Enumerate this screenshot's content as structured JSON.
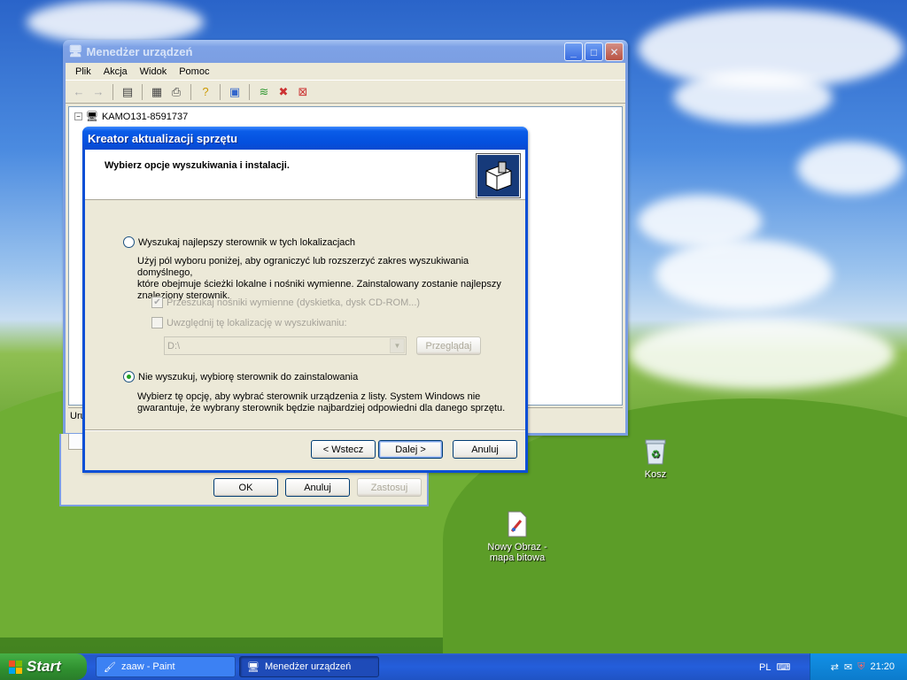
{
  "device_manager": {
    "title": "Menedżer urządzeń",
    "menu": [
      "Plik",
      "Akcja",
      "Widok",
      "Pomoc"
    ],
    "tree_root": "KAMO131-8591737",
    "status_partial": "Uru"
  },
  "properties_dialog": {
    "ok": "OK",
    "cancel": "Anuluj",
    "apply": "Zastosuj"
  },
  "wizard": {
    "title": "Kreator aktualizacji sprzętu",
    "header": "Wybierz opcje wyszukiwania i instalacji.",
    "option1": {
      "label": "Wyszukaj najlepszy sterownik w tych lokalizacjach",
      "description_lines": [
        "Użyj pól wyboru poniżej, aby ograniczyć lub rozszerzyć zakres wyszukiwania domyślnego,",
        "które obejmuje ścieżki lokalne i nośniki wymienne. Zainstalowany zostanie najlepszy",
        "znaleziony sterownik."
      ],
      "check_removable": "Przeszukaj nośniki wymienne (dyskietka, dysk CD-ROM...)",
      "check_location": "Uwzględnij tę lokalizację w wyszukiwaniu:",
      "path_value": "D:\\",
      "browse": "Przeglądaj"
    },
    "option2": {
      "label": "Nie wyszukuj, wybiorę sterownik do zainstalowania",
      "description_lines": [
        "Wybierz tę opcję, aby wybrać sterownik urządzenia z listy. System Windows nie",
        "gwarantuje, że wybrany sterownik będzie najbardziej odpowiedni dla danego sprzętu."
      ]
    },
    "back": "< Wstecz",
    "next": "Dalej >",
    "cancel": "Anuluj"
  },
  "desktop_icons": {
    "recycle_bin": "Kosz",
    "paint_file_line1": "Nowy Obraz -",
    "paint_file_line2": "mapa bitowa"
  },
  "taskbar": {
    "start": "Start",
    "tasks": [
      "zaaw - Paint",
      "Menedżer urządzeń"
    ],
    "language": "PL",
    "clock": "21:20"
  }
}
